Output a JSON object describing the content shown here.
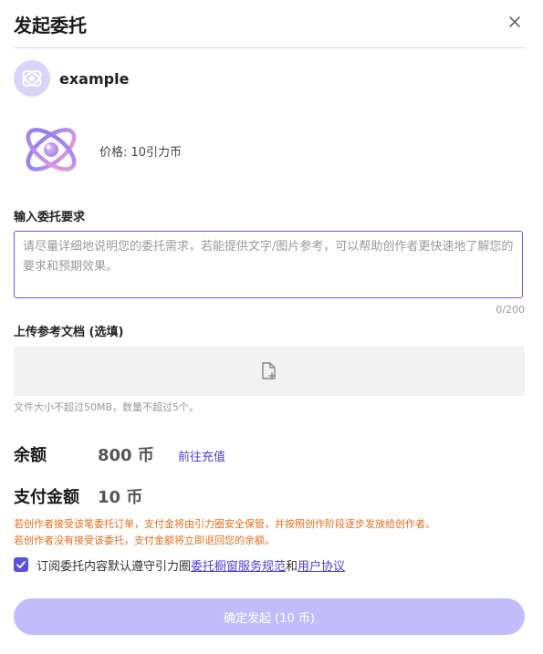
{
  "dialog": {
    "title": "发起委托",
    "close_icon": "close-icon"
  },
  "author": {
    "name": "example",
    "avatar_icon": "planet-atom-icon"
  },
  "product": {
    "icon": "planet-atom-icon",
    "price": "价格: 10引力币"
  },
  "requirement": {
    "label": "输入委托要求",
    "placeholder": "请尽量详细地说明您的委托需求，若能提供文字/图片参考，可以帮助创作者更快速地了解您的要求和预期效果。",
    "value": "",
    "counter": "0/200"
  },
  "upload": {
    "label": "上传参考文档 (选填)",
    "icon": "file-add-icon",
    "hint": "文件大小不超过50MB，数量不超过5个。"
  },
  "balance": {
    "label": "余额",
    "value": "800 币",
    "recharge_label": "前往充值"
  },
  "payment": {
    "label": "支付金额",
    "value": "10 币"
  },
  "notices": [
    "若创作者接受该笔委托订单，支付金将由引力圈安全保管，并按照创作阶段逐步发放给创作者。",
    "若创作者没有接受该委托，支付金额将立即退回您的余额。"
  ],
  "agreement": {
    "checked": true,
    "prefix": "订阅委托内容默认遵守引力圈",
    "link1": "委托橱窗服务规范",
    "conjunction": "和",
    "link2": "用户协议"
  },
  "submit_label": "确定发起 (10 币)",
  "colors": {
    "accent": "#5b4fe0",
    "link": "#4a3fd6",
    "submit_disabled": "#c2bdfa",
    "notice": "#e07020",
    "avatar_bg": "#d9d4fa"
  }
}
